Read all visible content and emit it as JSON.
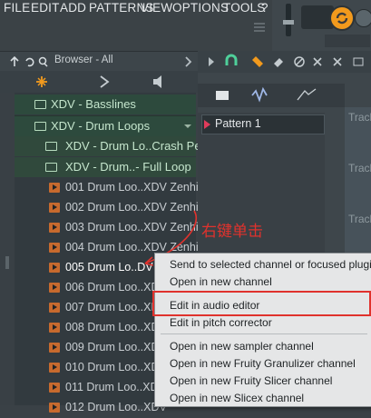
{
  "menubar": {
    "items": [
      "FILE",
      "EDIT",
      "ADD",
      "PATTERNS",
      "VIEW",
      "OPTIONS",
      "TOOLS",
      "?"
    ]
  },
  "browser": {
    "title": "Browser - All",
    "folders": [
      {
        "label": "XDV - Basslines"
      },
      {
        "label": "XDV - Drum Loops"
      },
      {
        "label": "XDV - Drum Lo..Crash Perc"
      },
      {
        "label": "XDV - Drum..- Full Loop"
      }
    ],
    "files": [
      "001 Drum Loo..XDV Zenhiser",
      "002 Drum Loo..XDV Zenhiser",
      "003 Drum Loo..XDV Zenhiser",
      "004 Drum Loo..XDV Zenhiser",
      "005 Drum Lo..DV",
      "006 Drum Loo..XDV",
      "007 Drum Loo..XDV",
      "008 Drum Loo..XDV",
      "009 Drum Loo..XDV",
      "010 Drum Loo..XDV",
      "011 Drum Loo..XDV",
      "012 Drum Loo..XDV"
    ]
  },
  "pattern": {
    "label": "Pattern 1"
  },
  "playlist": {
    "track_label": "Track"
  },
  "annotation": {
    "text": "右键单击",
    "color": "#e0322d"
  },
  "context_menu": {
    "items": [
      "Send to selected channel or focused plugin",
      "Open in new channel",
      "Edit in audio editor",
      "Edit in pitch corrector",
      "Open in new sampler channel",
      "Open in new Fruity Granulizer channel",
      "Open in new Fruity Slicer channel",
      "Open in new Slicex channel"
    ],
    "highlighted": "Edit in audio editor"
  },
  "colors": {
    "accent": "#f29a1d",
    "folder_bg": "#2d4a3d",
    "annotation": "#e0322d"
  }
}
